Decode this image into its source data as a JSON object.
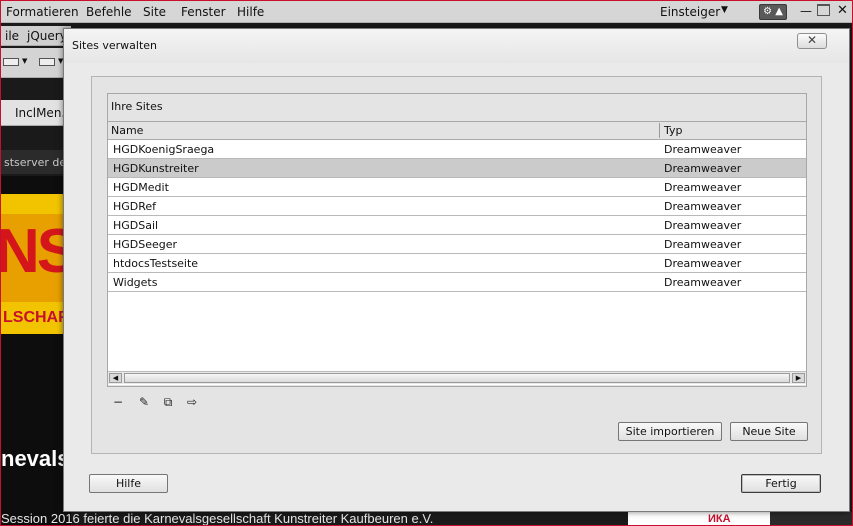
{
  "app": {
    "menu": [
      "Formatieren",
      "Befehle",
      "Site",
      "Fenster",
      "Hilfe"
    ],
    "workspace_label": "Einsteiger",
    "workspace_caret": "▼",
    "sync_label": "⚙ ▲",
    "min_label": "—",
    "close_label": "✕",
    "tabs": [
      "ile",
      "jQuery"
    ],
    "document_tab": "InclMen.p",
    "warning_text": "stserver defi",
    "preview": {
      "banner_letters": "NS",
      "banner_sub": "LSCHAF",
      "heading": "nevals",
      "bottom_text": "Session 2016 feierte die Karnevalsgesellschaft Kunstreiter Kaufbeuren e.V.",
      "strip_mark": "ИКА"
    }
  },
  "dialog": {
    "title": "Sites verwalten",
    "close_label": "✕",
    "group_label": "Ihre Sites",
    "columns": {
      "name": "Name",
      "type": "Typ"
    },
    "rows": [
      {
        "name": "HGDKoenigSraega",
        "type": "Dreamweaver",
        "selected": false
      },
      {
        "name": "HGDKunstreiter",
        "type": "Dreamweaver",
        "selected": true
      },
      {
        "name": "HGDMedit",
        "type": "Dreamweaver",
        "selected": false
      },
      {
        "name": "HGDRef",
        "type": "Dreamweaver",
        "selected": false
      },
      {
        "name": "HGDSail",
        "type": "Dreamweaver",
        "selected": false
      },
      {
        "name": "HGDSeeger",
        "type": "Dreamweaver",
        "selected": false
      },
      {
        "name": "htdocsTestseite",
        "type": "Dreamweaver",
        "selected": false
      },
      {
        "name": "Widgets",
        "type": "Dreamweaver",
        "selected": false
      }
    ],
    "scroll_left": "◀",
    "scroll_right": "▶",
    "tools": {
      "remove": "−",
      "edit": "✎",
      "duplicate": "⧉",
      "export": "⇨"
    },
    "buttons": {
      "import": "Site importieren",
      "new_site": "Neue Site",
      "help": "Hilfe",
      "done": "Fertig"
    }
  }
}
